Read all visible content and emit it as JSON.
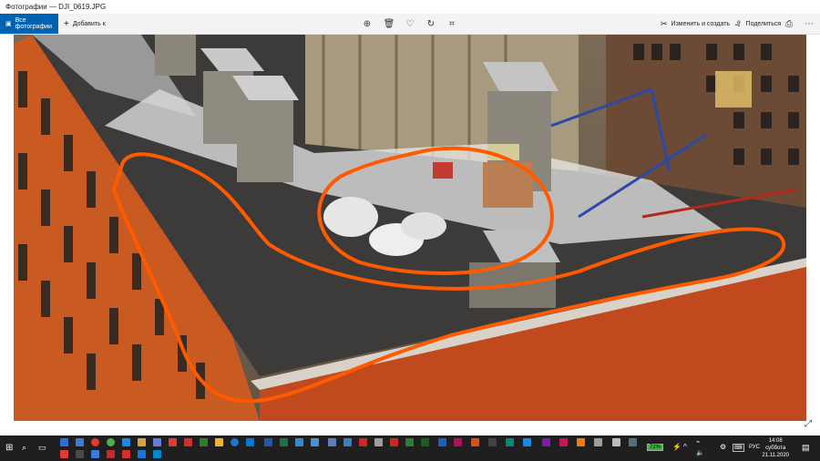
{
  "window": {
    "title": "Фотографии — DJI_0619.JPG"
  },
  "toolbar": {
    "all_photos_label": "Все фотографии",
    "add_to_label": "Добавить к",
    "edit_create_label": "Изменить и создать",
    "share_label": "Поделиться",
    "icons": [
      "zoom-icon",
      "delete-icon",
      "favorite-icon",
      "rotate-icon",
      "crop-icon",
      "print-icon",
      "more-icon"
    ]
  },
  "taskbar": {
    "battery_label": "72%",
    "language": "РУС",
    "time": "14:08",
    "day": "суббота",
    "date": "21.11.2020",
    "accent": "#ff6a13"
  },
  "colors": {
    "accent_blue": "#0063b1",
    "annotation_orange": "#ff5a00"
  }
}
